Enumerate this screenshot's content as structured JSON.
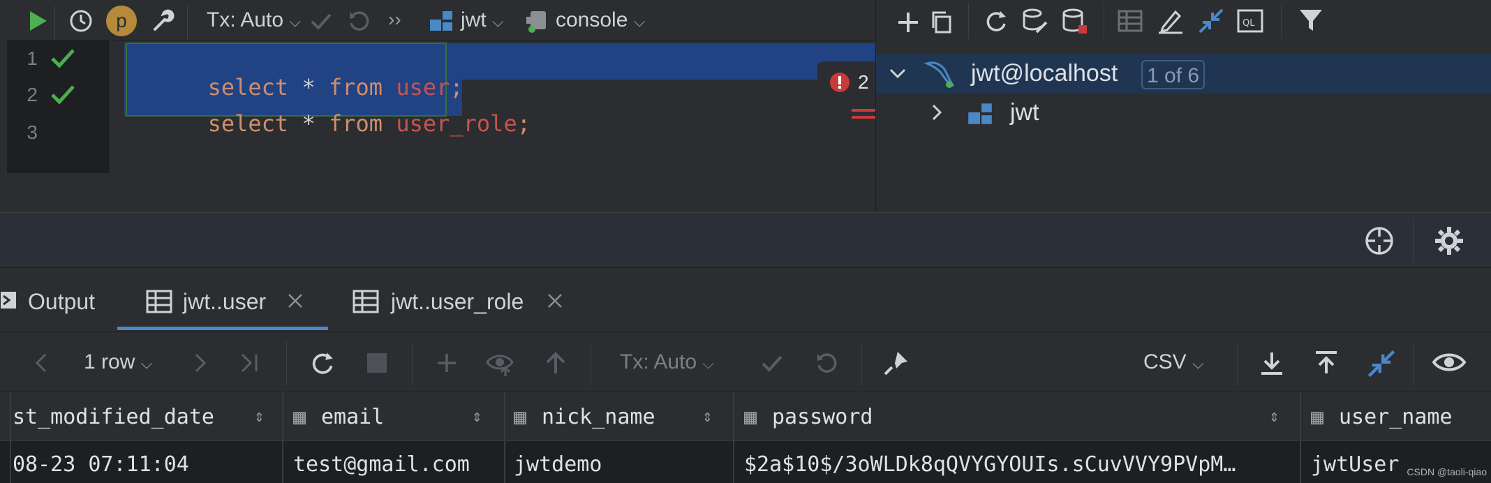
{
  "editor_toolbar": {
    "tx_label": "Tx: Auto",
    "schema_label": "jwt",
    "console_label": "console",
    "profile_letter": "p"
  },
  "editor": {
    "line_numbers": [
      "1",
      "2",
      "3"
    ],
    "lines": [
      {
        "kw1": "select",
        "op": "*",
        "kw2": "from",
        "table": "user",
        "end": ";"
      },
      {
        "kw1": "select",
        "op": "*",
        "kw2": "from",
        "table": "user_role",
        "end": ";"
      }
    ],
    "problems_count": "2"
  },
  "db_tree": {
    "connection_label": "jwt@localhost",
    "connection_badge": "1 of 6",
    "schema_label": "jwt"
  },
  "tabs": [
    {
      "label": "Output"
    },
    {
      "label": "jwt..user"
    },
    {
      "label": "jwt..user_role"
    }
  ],
  "results_toolbar": {
    "rows_label": "1 row",
    "tx_label": "Tx: Auto",
    "export_format": "CSV"
  },
  "grid": {
    "columns": [
      "st_modified_date",
      "email",
      "nick_name",
      "password",
      "user_name"
    ],
    "rows": [
      [
        "08-23 07:11:04",
        "test@gmail.com",
        "jwtdemo",
        "$2a$10$/3oWLDk8qQVYGYOUIs.sCuvVVY9PVpM…",
        "jwtUser"
      ]
    ]
  },
  "watermark": "CSDN @taoli-qiao",
  "colors": {
    "run_green": "#4caf50",
    "selection": "#214283",
    "accent_blue": "#4a88c7",
    "error_red": "#c93b3b",
    "keyword": "#cf8e6d",
    "identifier": "#c75450"
  }
}
